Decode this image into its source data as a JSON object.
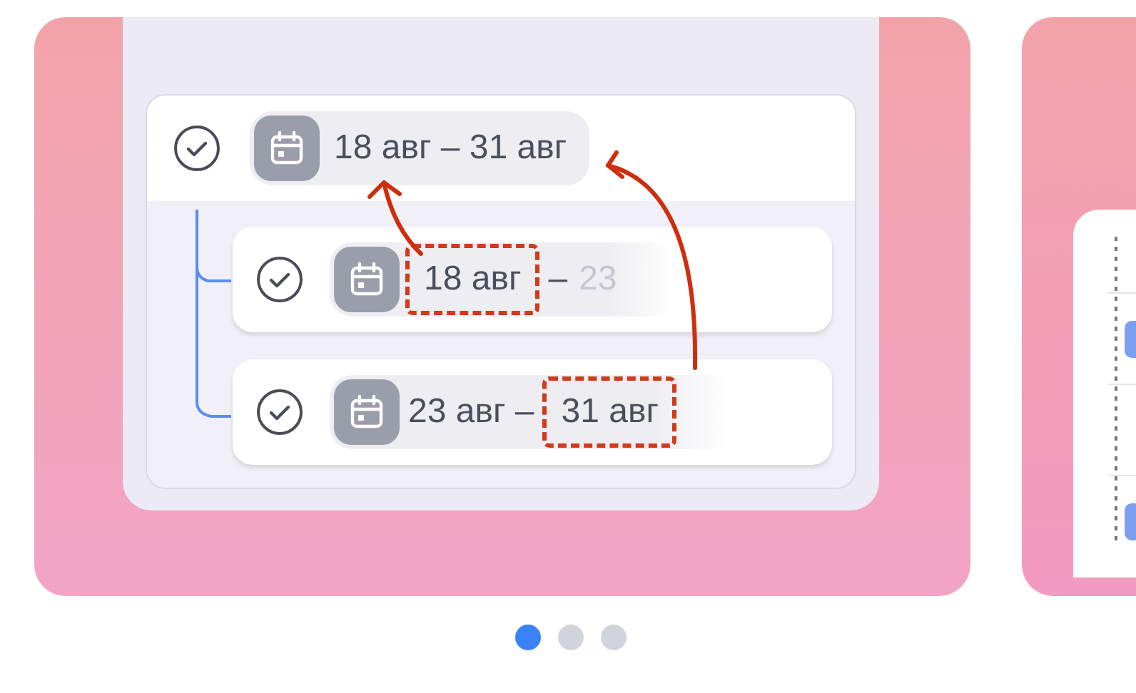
{
  "slide": {
    "parent": {
      "checked": true,
      "text": "18 авг – 31 авг"
    },
    "children": [
      {
        "checked": true,
        "parts": [
          {
            "text": "18 авг",
            "faded": false,
            "highlighted": true
          },
          {
            "text": "–",
            "faded": false,
            "highlighted": false
          },
          {
            "text": "23",
            "faded": true,
            "highlighted": false
          }
        ]
      },
      {
        "checked": true,
        "parts": [
          {
            "text": "23 авг –",
            "faded": false,
            "highlighted": false
          },
          {
            "text": "31 авг",
            "faded": false,
            "highlighted": true
          }
        ]
      }
    ]
  },
  "pagination": [
    {
      "selected": true
    },
    {
      "selected": false
    },
    {
      "selected": false
    }
  ]
}
